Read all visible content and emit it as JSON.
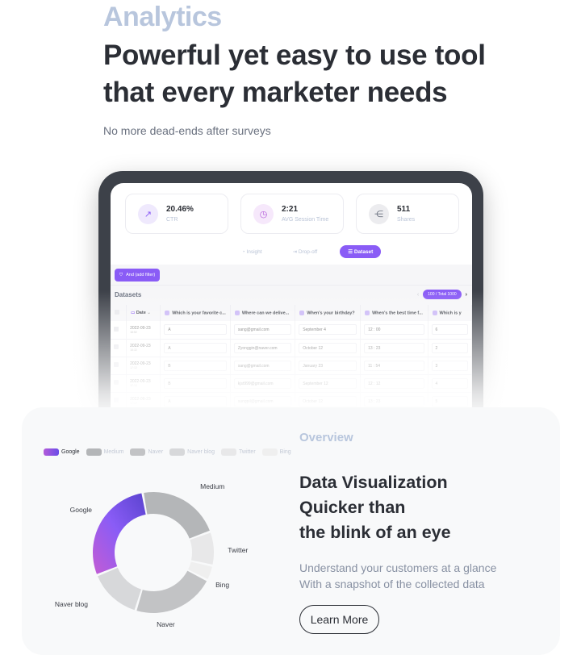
{
  "hero": {
    "eyebrow": "Analytics",
    "headline_line1": "Powerful yet easy to use tool",
    "headline_line2": "that every marketer needs",
    "subtitle": "No more dead-ends after surveys"
  },
  "dashboard": {
    "stats": [
      {
        "value": "20.46%",
        "label": "CTR",
        "icon": "external-link-icon",
        "icon_bg": "#efe9fd",
        "icon_color": "#8a5cf6"
      },
      {
        "value": "2:21",
        "label": "AVG Session Time",
        "icon": "clock-icon",
        "icon_bg": "#f6e8fb",
        "icon_color": "#b35bd9"
      },
      {
        "value": "511",
        "label": "Shares",
        "icon": "share-icon",
        "icon_bg": "#ececef",
        "icon_color": "#6b7280"
      }
    ],
    "tabs": [
      {
        "label": "Insight",
        "icon": "pie-chart-icon",
        "active": false
      },
      {
        "label": "Drop-off",
        "icon": "exit-icon",
        "active": false
      },
      {
        "label": "Dataset",
        "icon": "list-icon",
        "active": true
      }
    ],
    "filter_button": "And (add filter)",
    "datasets_title": "Datasets",
    "pager": {
      "prev": "‹",
      "label": "100 / Total 1000",
      "next": "›"
    },
    "columns": [
      "Date",
      "Which is your favorite c...",
      "Where can we delive...",
      "When's your birthday?",
      "When's the best time f...",
      "Which is y"
    ],
    "rows": [
      {
        "date": "2022-09-23",
        "time": "18:52",
        "cells": [
          "A",
          "sang@gmail.com",
          "September 4",
          "12 : 00",
          "6"
        ]
      },
      {
        "date": "2022-09-23",
        "time": "18:32",
        "cells": [
          "A",
          "Zyonggin@naver.com",
          "October 12",
          "13 : 23",
          "2"
        ]
      },
      {
        "date": "2022-09-23",
        "time": "17:12",
        "cells": [
          "B",
          "sang@gmail.com",
          "January 23",
          "11 : 54",
          "3"
        ]
      },
      {
        "date": "2022-09-23",
        "time": "17:12",
        "cells": [
          "B",
          "kjst999@gmail.com",
          "September 12",
          "12 : 12",
          "4"
        ]
      },
      {
        "date": "2022-09-23",
        "time": "17:12",
        "cells": [
          "A",
          "sungpil@gmail.com",
          "October 12",
          "13 : 23",
          "5"
        ]
      }
    ]
  },
  "overview": {
    "eyebrow": "Overview",
    "title_line1": "Data Visualization",
    "title_line2": "Quicker than",
    "title_line3": "the blink of an eye",
    "desc_line1": "Understand your customers at a glance",
    "desc_line2": "With a snapshot of the collected data",
    "button": "Learn More"
  },
  "chart_data": {
    "type": "pie",
    "variant": "donut",
    "title": "",
    "legend_position": "top-left",
    "categories": [
      "Google",
      "Medium",
      "Naver",
      "Naver blog",
      "Twitter",
      "Bing"
    ],
    "values": [
      28,
      22,
      22,
      14,
      9,
      4
    ],
    "colors": [
      "#8a5cf6",
      "#b4b6b8",
      "#c2c3c5",
      "#d7d8da",
      "#e8e8e9",
      "#efefef"
    ],
    "order_clockwise_from_top_left": [
      "Google",
      "Medium",
      "Twitter",
      "Bing",
      "Naver",
      "Naver blog"
    ],
    "legend": [
      "Google",
      "Medium",
      "Naver",
      "Naver blog",
      "Twitter",
      "Bing"
    ]
  }
}
